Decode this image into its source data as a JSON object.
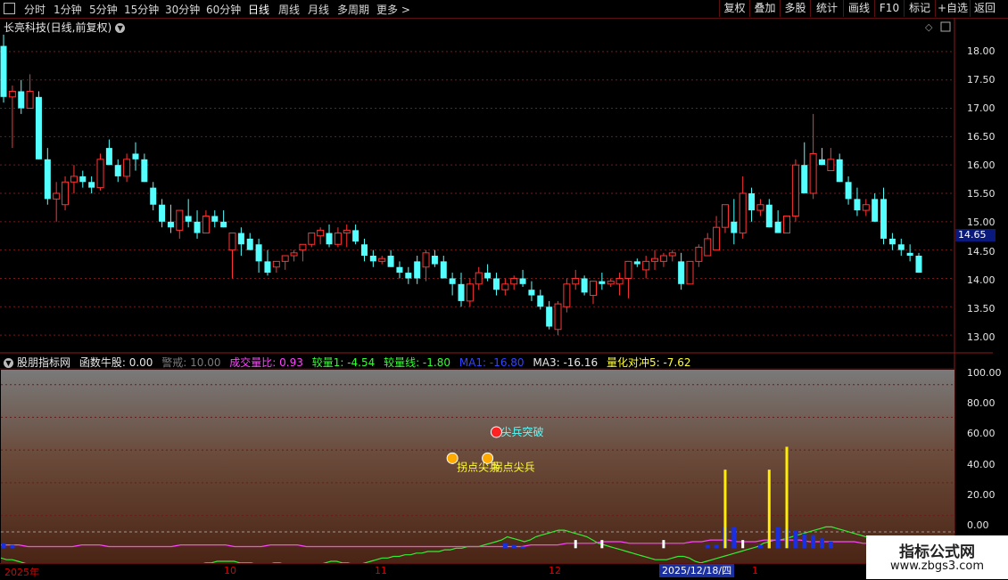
{
  "toolbar": {
    "periods": [
      "分时",
      "1分钟",
      "5分钟",
      "15分钟",
      "30分钟",
      "60分钟",
      "日线",
      "周线",
      "月线",
      "多周期",
      "更多 >"
    ],
    "active_period": "日线",
    "buttons": [
      "复权",
      "叠加",
      "多股",
      "统计",
      "画线",
      "F10",
      "标记",
      "+自选",
      "返回"
    ]
  },
  "stock_title": "长亮科技(日线,前复权)",
  "price_axis": {
    "ticks": [
      "18.00",
      "17.50",
      "17.00",
      "16.50",
      "16.00",
      "15.50",
      "15.00",
      "14.50",
      "14.00",
      "13.50",
      "13.00"
    ],
    "current_price": "14.65"
  },
  "indicator": {
    "name": "股朋指标网",
    "items": [
      {
        "label": "函数牛股: 0.00",
        "color": "#e8e8e8"
      },
      {
        "label": "警戒: 10.00",
        "color": "#7a7a7a"
      },
      {
        "label": "成交量比: 0.93",
        "color": "#ff44ff"
      },
      {
        "label": "较量1: -4.54",
        "color": "#33ff33"
      },
      {
        "label": "较量线: -1.80",
        "color": "#33ff33"
      },
      {
        "label": "MA1: -16.80",
        "color": "#3344ff"
      },
      {
        "label": "MA3: -16.16",
        "color": "#e8e8e8"
      },
      {
        "label": "量化对冲5: -7.62",
        "color": "#ffff33"
      }
    ],
    "axis_ticks": [
      "100.00",
      "80.00",
      "60.00",
      "40.00",
      "20.00",
      "0.00"
    ],
    "signals": [
      {
        "label": "拐点尖兵",
        "index": 51
      },
      {
        "label": "拐点尖兵",
        "index": 55
      },
      {
        "label": "尖兵突破",
        "index": 56
      }
    ]
  },
  "date_axis": {
    "labels": [
      "2025年",
      "10",
      "11",
      "12",
      "1"
    ],
    "cursor_date": "2025/12/18/四"
  },
  "watermark": {
    "title": "指标公式网",
    "url": "www.zbgs3.com"
  },
  "colors": {
    "up": "#ff3333",
    "down": "#54ffff",
    "grid": "#7a1818"
  },
  "chart_data": {
    "type": "candlestick",
    "ylim": [
      12.75,
      18.25
    ],
    "candles": [
      [
        18.1,
        18.3,
        17.1,
        17.2
      ],
      [
        17.2,
        17.4,
        16.3,
        17.3
      ],
      [
        17.3,
        17.5,
        16.9,
        17.0
      ],
      [
        17.0,
        17.6,
        17.2,
        17.3
      ],
      [
        17.2,
        17.3,
        16.1,
        16.1
      ],
      [
        16.1,
        16.3,
        15.3,
        15.4
      ],
      [
        15.4,
        15.7,
        15.0,
        15.5
      ],
      [
        15.3,
        15.8,
        15.2,
        15.7
      ],
      [
        15.7,
        16.0,
        15.5,
        15.8
      ],
      [
        15.8,
        15.9,
        15.6,
        15.7
      ],
      [
        15.7,
        15.8,
        15.5,
        15.6
      ],
      [
        15.6,
        16.2,
        15.55,
        16.1
      ],
      [
        16.3,
        16.45,
        16.0,
        16.0
      ],
      [
        16.0,
        16.1,
        15.7,
        15.8
      ],
      [
        15.8,
        16.2,
        15.7,
        16.1
      ],
      [
        16.2,
        16.4,
        15.9,
        16.1
      ],
      [
        16.1,
        16.2,
        15.7,
        15.7
      ],
      [
        15.6,
        15.7,
        15.2,
        15.3
      ],
      [
        15.3,
        15.4,
        14.9,
        15.0
      ],
      [
        15.0,
        15.3,
        14.8,
        14.9
      ],
      [
        14.85,
        15.2,
        14.7,
        15.2
      ],
      [
        15.1,
        15.4,
        14.9,
        15.0
      ],
      [
        15.0,
        15.2,
        14.7,
        14.8
      ],
      [
        14.8,
        15.2,
        14.8,
        15.1
      ],
      [
        15.1,
        15.2,
        14.9,
        15.0
      ],
      [
        15.0,
        15.2,
        14.9,
        14.9
      ],
      [
        14.5,
        14.8,
        14.0,
        14.8
      ],
      [
        14.8,
        14.9,
        14.4,
        14.6
      ],
      [
        14.7,
        14.8,
        14.5,
        14.5
      ],
      [
        14.6,
        14.7,
        14.1,
        14.3
      ],
      [
        14.3,
        14.5,
        14.05,
        14.1
      ],
      [
        14.2,
        14.3,
        14.1,
        14.3
      ],
      [
        14.3,
        14.4,
        14.15,
        14.4
      ],
      [
        14.4,
        14.5,
        14.3,
        14.45
      ],
      [
        14.5,
        14.6,
        14.3,
        14.6
      ],
      [
        14.6,
        14.8,
        14.55,
        14.8
      ],
      [
        14.75,
        14.9,
        14.6,
        14.85
      ],
      [
        14.8,
        14.95,
        14.55,
        14.6
      ],
      [
        14.6,
        14.9,
        14.55,
        14.8
      ],
      [
        14.8,
        14.95,
        14.55,
        14.85
      ],
      [
        14.85,
        14.95,
        14.6,
        14.65
      ],
      [
        14.6,
        14.7,
        14.3,
        14.4
      ],
      [
        14.4,
        14.5,
        14.2,
        14.3
      ],
      [
        14.3,
        14.4,
        14.25,
        14.35
      ],
      [
        14.4,
        14.5,
        14.2,
        14.2
      ],
      [
        14.2,
        14.3,
        14.0,
        14.1
      ],
      [
        14.1,
        14.2,
        13.9,
        14.0
      ],
      [
        14.3,
        14.4,
        13.9,
        14.0
      ],
      [
        14.2,
        14.5,
        13.95,
        14.45
      ],
      [
        14.4,
        14.5,
        14.2,
        14.25
      ],
      [
        14.3,
        14.4,
        14.0,
        14.0
      ],
      [
        14.0,
        14.1,
        13.7,
        13.9
      ],
      [
        13.9,
        14.1,
        13.5,
        13.6
      ],
      [
        13.6,
        14.0,
        13.5,
        13.9
      ],
      [
        13.9,
        14.2,
        13.8,
        14.1
      ],
      [
        14.1,
        14.25,
        13.95,
        14.0
      ],
      [
        14.0,
        14.1,
        13.7,
        13.8
      ],
      [
        13.8,
        14.0,
        13.7,
        13.9
      ],
      [
        13.9,
        14.05,
        13.8,
        14.0
      ],
      [
        14.0,
        14.15,
        13.85,
        13.9
      ],
      [
        13.8,
        13.95,
        13.6,
        13.7
      ],
      [
        13.7,
        13.8,
        13.45,
        13.5
      ],
      [
        13.5,
        13.6,
        13.1,
        13.15
      ],
      [
        13.1,
        13.6,
        13.0,
        13.55
      ],
      [
        13.5,
        14.0,
        13.4,
        13.9
      ],
      [
        13.9,
        14.15,
        13.8,
        14.0
      ],
      [
        14.0,
        14.05,
        13.7,
        13.75
      ],
      [
        13.7,
        13.95,
        13.55,
        13.95
      ],
      [
        13.95,
        14.1,
        13.8,
        13.9
      ],
      [
        13.9,
        14.0,
        13.85,
        13.95
      ],
      [
        13.9,
        14.1,
        13.7,
        14.0
      ],
      [
        14.0,
        14.3,
        13.65,
        14.3
      ],
      [
        14.3,
        14.35,
        14.2,
        14.25
      ],
      [
        14.15,
        14.4,
        14.0,
        14.3
      ],
      [
        14.3,
        14.5,
        14.15,
        14.35
      ],
      [
        14.3,
        14.45,
        14.2,
        14.4
      ],
      [
        14.4,
        14.5,
        14.3,
        14.45
      ],
      [
        14.3,
        14.45,
        13.8,
        13.9
      ],
      [
        13.9,
        14.3,
        13.9,
        14.3
      ],
      [
        14.3,
        14.6,
        14.2,
        14.55
      ],
      [
        14.4,
        14.8,
        14.4,
        14.7
      ],
      [
        14.5,
        15.1,
        14.5,
        14.9
      ],
      [
        14.9,
        15.3,
        14.8,
        15.3
      ],
      [
        15.0,
        15.4,
        14.6,
        14.8
      ],
      [
        14.8,
        15.8,
        14.7,
        15.5
      ],
      [
        15.5,
        15.6,
        15.0,
        15.2
      ],
      [
        15.2,
        15.4,
        15.1,
        15.3
      ],
      [
        15.3,
        15.4,
        14.9,
        14.9
      ],
      [
        15.0,
        15.2,
        14.8,
        14.8
      ],
      [
        14.8,
        15.1,
        14.8,
        15.1
      ],
      [
        15.1,
        16.1,
        15.0,
        16.0
      ],
      [
        16.0,
        16.4,
        15.5,
        15.5
      ],
      [
        15.5,
        16.9,
        15.4,
        16.2
      ],
      [
        16.1,
        16.3,
        16.0,
        16.0
      ],
      [
        15.9,
        16.3,
        15.9,
        16.1
      ],
      [
        16.1,
        16.2,
        15.7,
        15.7
      ],
      [
        15.7,
        15.8,
        15.3,
        15.4
      ],
      [
        15.4,
        15.6,
        15.1,
        15.2
      ],
      [
        15.2,
        15.4,
        15.1,
        15.3
      ],
      [
        15.4,
        15.5,
        15.0,
        15.0
      ],
      [
        15.4,
        15.6,
        14.6,
        14.7
      ],
      [
        14.7,
        14.8,
        14.5,
        14.6
      ],
      [
        14.6,
        14.7,
        14.4,
        14.5
      ],
      [
        14.45,
        14.6,
        14.3,
        14.4
      ],
      [
        14.4,
        14.45,
        14.1,
        14.1
      ]
    ],
    "bottom_panel": {
      "ylim": [
        -8,
        108
      ],
      "warning_level": 10,
      "green_line": [
        -6,
        -7,
        -7,
        -8,
        -9,
        -10,
        -11,
        -11,
        -11,
        -12,
        -12,
        -12,
        -13,
        -12,
        -11,
        -11,
        -12,
        -12,
        -13,
        -13,
        -12,
        -12,
        -13,
        -13,
        -13,
        -12,
        -13,
        -14,
        -14,
        -14,
        -13,
        -13,
        -12,
        -11,
        -10,
        -10,
        -9,
        -9,
        -8,
        -8,
        -8,
        -8,
        -9,
        -9,
        -9,
        -10,
        -10,
        -10,
        -9,
        -9,
        -10,
        -10,
        -11,
        -11,
        -11,
        -10,
        -10,
        -9,
        -8,
        -8,
        -9,
        -9,
        -10,
        -10,
        -9,
        -8,
        -7,
        -6,
        -6,
        -5,
        -5,
        -4,
        -4,
        -3,
        -3,
        -2,
        -2,
        -2,
        -1,
        -1,
        0,
        0,
        1,
        1,
        1,
        2,
        3,
        4,
        5,
        7,
        6,
        5,
        4,
        5,
        7,
        8,
        9,
        10,
        11,
        11,
        10,
        9,
        8,
        7,
        5,
        3,
        2,
        1,
        0,
        -1,
        -2,
        -3,
        -4,
        -5,
        -6,
        -7,
        -7,
        -7,
        -6,
        -5,
        -5,
        -6,
        -8,
        -9,
        -8,
        -7,
        -6,
        -5,
        -4,
        -3,
        -2,
        -1,
        0,
        1,
        3,
        4,
        5,
        5,
        6,
        7,
        8,
        9,
        10,
        11,
        12,
        13,
        13,
        12,
        11,
        10,
        9,
        8,
        7,
        6,
        5,
        4,
        3,
        2,
        1,
        0,
        -1,
        -3
      ],
      "magenta_line": [
        2,
        2,
        2,
        1,
        1,
        1,
        1,
        1,
        1,
        2,
        2,
        2,
        1,
        1,
        1,
        1,
        1,
        1,
        1,
        1,
        2,
        2,
        2,
        2,
        2,
        2,
        1,
        1,
        1,
        1,
        2,
        2,
        2,
        2,
        1,
        1,
        1,
        1,
        1,
        1,
        1,
        1,
        1,
        1,
        1,
        1,
        1,
        1,
        1,
        1,
        1,
        1,
        1,
        1,
        1,
        1,
        1,
        1,
        1,
        2,
        2,
        2,
        2,
        3,
        3,
        3,
        3,
        4,
        4,
        4,
        3,
        3,
        3,
        3,
        3,
        3,
        3,
        4,
        4,
        5,
        5,
        5,
        4,
        4,
        4,
        5,
        5,
        5,
        5,
        5,
        4,
        4,
        4,
        4,
        4,
        4,
        3,
        3,
        3,
        3,
        2,
        2,
        1
      ],
      "blue_bars": [
        [
          0,
          3
        ],
        [
          1,
          2
        ],
        [
          57,
          3
        ],
        [
          58,
          2
        ],
        [
          59,
          1
        ],
        [
          80,
          2
        ],
        [
          81,
          2
        ],
        [
          82,
          13
        ],
        [
          83,
          13
        ],
        [
          86,
          2
        ],
        [
          88,
          13
        ],
        [
          89,
          12
        ],
        [
          90,
          11
        ],
        [
          91,
          9
        ],
        [
          92,
          8
        ],
        [
          93,
          6
        ],
        [
          94,
          4
        ]
      ],
      "white_bars": [
        [
          65,
          5
        ],
        [
          68,
          5
        ],
        [
          75,
          5
        ],
        [
          84,
          5
        ],
        [
          87,
          5
        ]
      ],
      "yellow_bars": [
        [
          82,
          48
        ],
        [
          87,
          48
        ],
        [
          89,
          62
        ]
      ]
    }
  }
}
